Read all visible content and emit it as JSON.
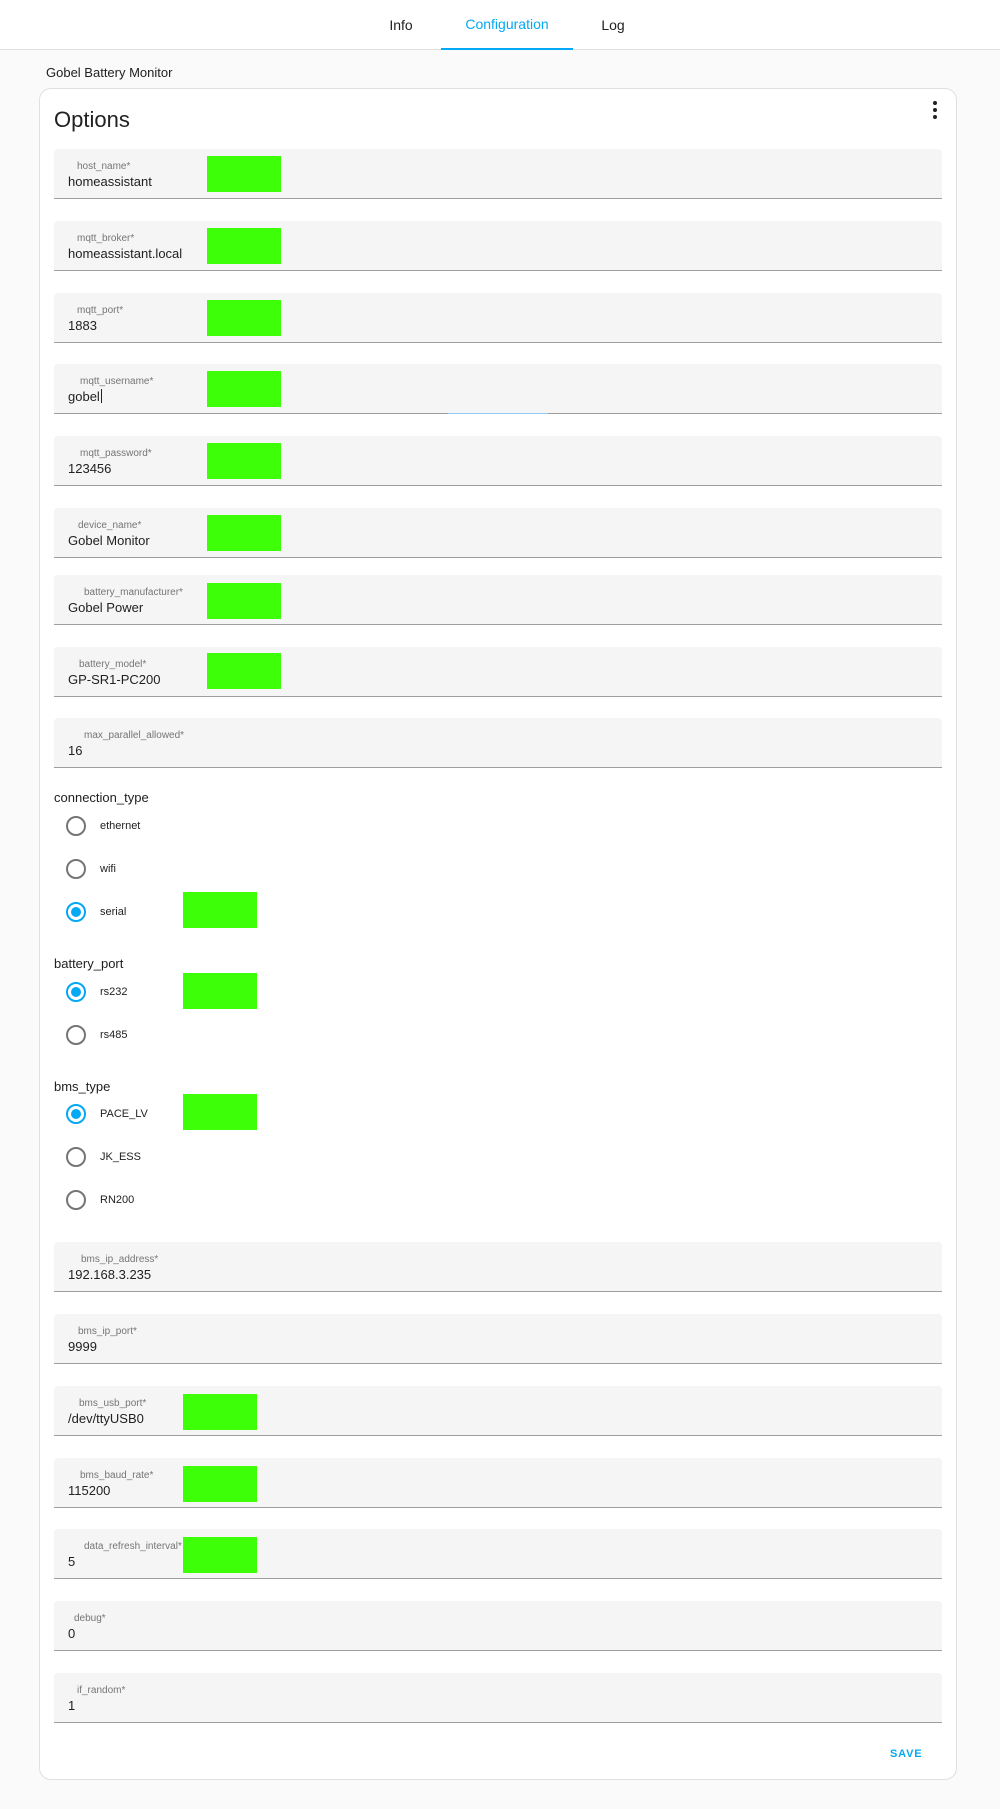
{
  "tabs": [
    {
      "label": "Info",
      "active": false
    },
    {
      "label": "Configuration",
      "active": true
    },
    {
      "label": "Log",
      "active": false
    }
  ],
  "addon_title": "Gobel Battery Monitor",
  "card": {
    "title": "Options",
    "save_label": "SAVE"
  },
  "accent_color": "#03a9f4",
  "highlight_color": "#3dff07",
  "fields": [
    {
      "label": "host_name*",
      "value": "homeassistant"
    },
    {
      "label": "mqtt_broker*",
      "value": "homeassistant.local"
    },
    {
      "label": "mqtt_port*",
      "value": "1883"
    },
    {
      "label": "mqtt_username*",
      "value": "gobel"
    },
    {
      "label": "mqtt_password*",
      "value": "123456"
    },
    {
      "label": "device_name*",
      "value": "Gobel Monitor"
    },
    {
      "label": "battery_manufacturer*",
      "value": "Gobel Power"
    },
    {
      "label": "battery_model*",
      "value": "GP-SR1-PC200"
    },
    {
      "label": "max_parallel_allowed*",
      "value": "16"
    },
    {
      "label": "bms_ip_address*",
      "value": "192.168.3.235"
    },
    {
      "label": "bms_ip_port*",
      "value": "9999"
    },
    {
      "label": "bms_usb_port*",
      "value": "/dev/ttyUSB0"
    },
    {
      "label": "bms_baud_rate*",
      "value": "115200"
    },
    {
      "label": "data_refresh_interval*",
      "value": "5"
    },
    {
      "label": "debug*",
      "value": "0"
    },
    {
      "label": "if_random*",
      "value": "1"
    }
  ],
  "radio_groups": {
    "connection_type": {
      "label": "connection_type",
      "options": [
        "ethernet",
        "wifi",
        "serial"
      ],
      "selected": "serial"
    },
    "battery_port": {
      "label": "battery_port",
      "options": [
        "rs232",
        "rs485"
      ],
      "selected": "rs232"
    },
    "bms_type": {
      "label": "bms_type",
      "options": [
        "PACE_LV",
        "JK_ESS",
        "RN200"
      ],
      "selected": "PACE_LV"
    }
  }
}
